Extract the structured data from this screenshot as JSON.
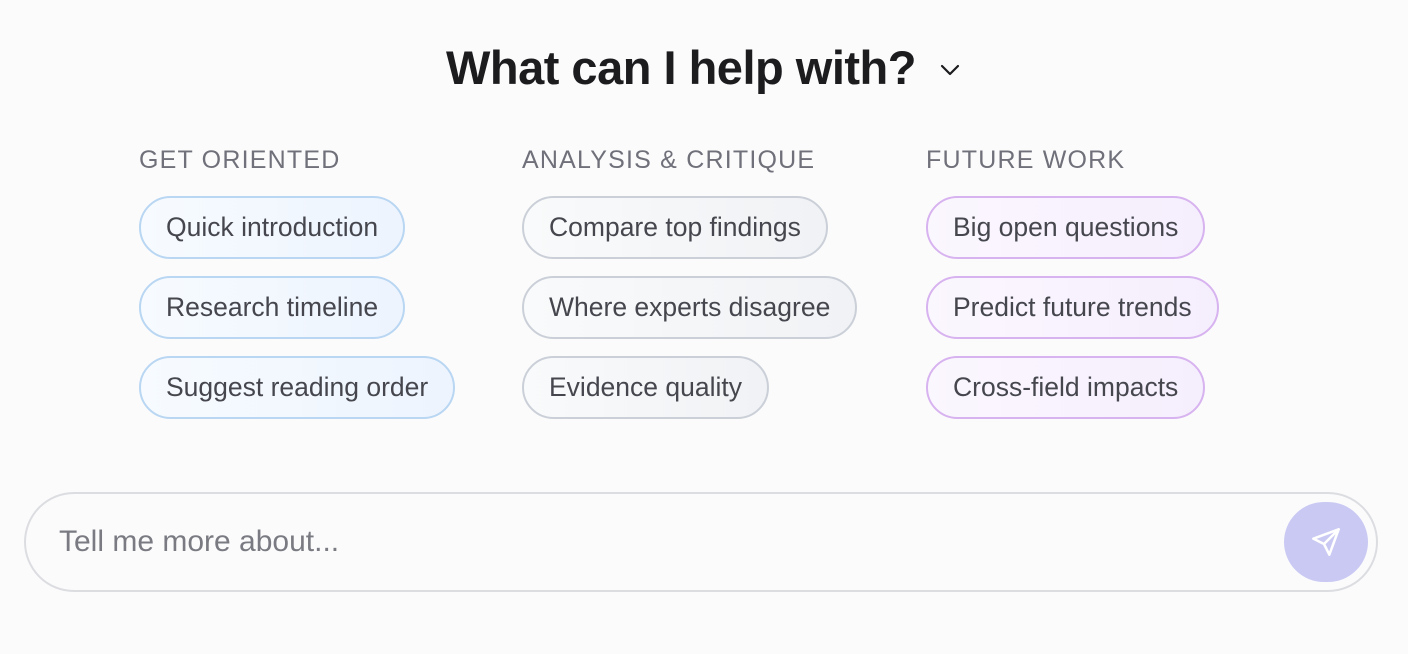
{
  "header": {
    "title": "What can I help with?",
    "chevron_icon": "chevron-down-icon"
  },
  "columns": [
    {
      "heading": "GET ORIENTED",
      "accent": "#b9d6f2",
      "chips": [
        "Quick introduction",
        "Research timeline",
        "Suggest reading order"
      ]
    },
    {
      "heading": "ANALYSIS & CRITIQUE",
      "accent": "#cbd0d8",
      "chips": [
        "Compare top findings",
        "Where experts disagree",
        "Evidence quality"
      ]
    },
    {
      "heading": "FUTURE WORK",
      "accent": "#d7b3ef",
      "chips": [
        "Big open questions",
        "Predict future trends",
        "Cross-field impacts"
      ]
    }
  ],
  "composer": {
    "placeholder": "Tell me more about...",
    "value": "",
    "send_icon": "send-icon",
    "send_color": "#c9c9f3"
  }
}
